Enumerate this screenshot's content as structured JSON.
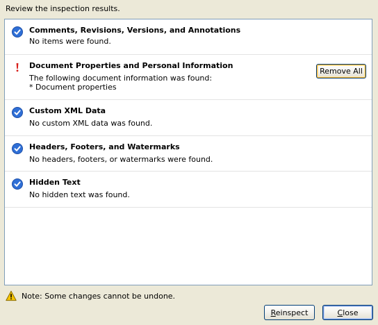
{
  "header": {
    "instruction": "Review the inspection results."
  },
  "results": [
    {
      "status": "ok",
      "icon": "check-icon",
      "title": "Comments, Revisions, Versions, and Annotations",
      "lines": [
        "No items were found."
      ]
    },
    {
      "status": "found",
      "icon": "exclamation-icon",
      "title": "Document Properties and Personal Information",
      "lines": [
        "The following document information was found:",
        "* Document properties"
      ],
      "action_label": "Remove All"
    },
    {
      "status": "ok",
      "icon": "check-icon",
      "title": "Custom XML Data",
      "lines": [
        "No custom XML data was found."
      ]
    },
    {
      "status": "ok",
      "icon": "check-icon",
      "title": "Headers, Footers, and Watermarks",
      "lines": [
        "No headers, footers, or watermarks were found."
      ]
    },
    {
      "status": "ok",
      "icon": "check-icon",
      "title": "Hidden Text",
      "lines": [
        "No hidden text was found."
      ]
    }
  ],
  "footer": {
    "note_icon": "warning-icon",
    "note": "Note: Some changes cannot be undone.",
    "reinspect_mnemonic": "R",
    "reinspect_rest": "einspect",
    "close_mnemonic": "C",
    "close_rest": "lose"
  },
  "colors": {
    "dialog_bg": "#ece9d8",
    "check_blue": "#2f6fd6",
    "alert_red": "#d8201c",
    "warning_yellow": "#f5c400",
    "button_border": "#003c74"
  }
}
